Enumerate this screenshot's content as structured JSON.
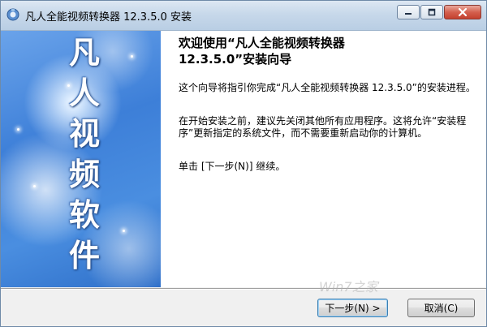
{
  "window": {
    "title": "凡人全能视频转换器 12.3.5.0 安装"
  },
  "banner": {
    "characters": [
      "凡",
      "人",
      "视",
      "频",
      "软",
      "件"
    ]
  },
  "content": {
    "heading_line1": "欢迎使用“凡人全能视频转换器",
    "heading_line2": "12.3.5.0”安装向导",
    "para1": "这个向导将指引你完成“凡人全能视频转换器 12.3.5.0”的安装进程。",
    "para2": "在开始安装之前，建议先关闭其他所有应用程序。这将允许“安装程序”更新指定的系统文件，而不需要重新启动你的计算机。",
    "para3": "单击 [下一步(N)] 继续。"
  },
  "buttons": {
    "next_label": "下一步(N) >",
    "cancel_label": "取消(C)"
  },
  "watermark": "Win7之家",
  "colors": {
    "banner_blue": "#3d7fd8",
    "close_red": "#c4402e",
    "titlebar": "#c7d8ea"
  }
}
